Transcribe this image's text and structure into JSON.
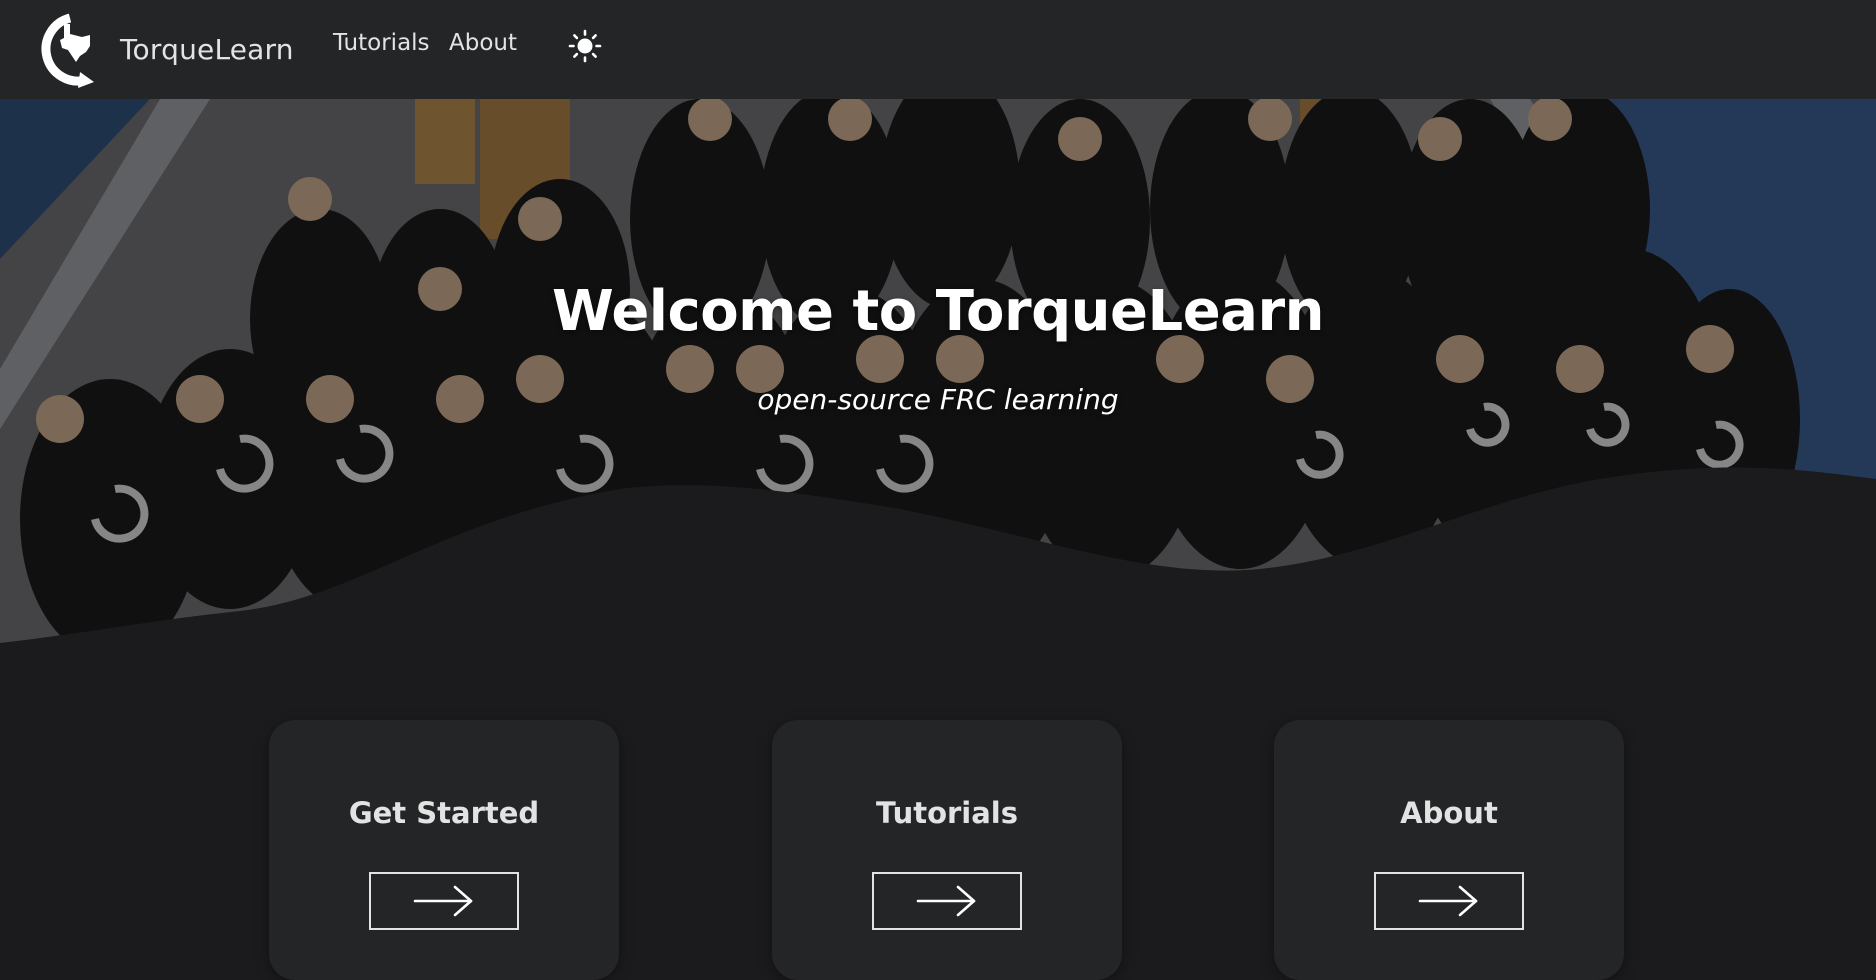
{
  "navbar": {
    "brand_title": "TorqueLearn",
    "links": [
      {
        "label": "Tutorials"
      },
      {
        "label": "About"
      }
    ],
    "theme_toggle_icon": "sun-icon"
  },
  "hero": {
    "title": "Welcome to TorqueLearn",
    "subtitle": "open-source FRC learning",
    "background": "team-photo"
  },
  "cards": [
    {
      "title": "Get Started",
      "button_icon": "arrow-right-icon"
    },
    {
      "title": "Tutorials",
      "button_icon": "arrow-right-icon"
    },
    {
      "title": "About",
      "button_icon": "arrow-right-icon"
    }
  ],
  "colors": {
    "navbar_bg": "#242526",
    "page_bg": "#1b1b1d",
    "card_bg": "#242526",
    "text": "#e3e3e3",
    "hero_text": "#ffffff"
  }
}
